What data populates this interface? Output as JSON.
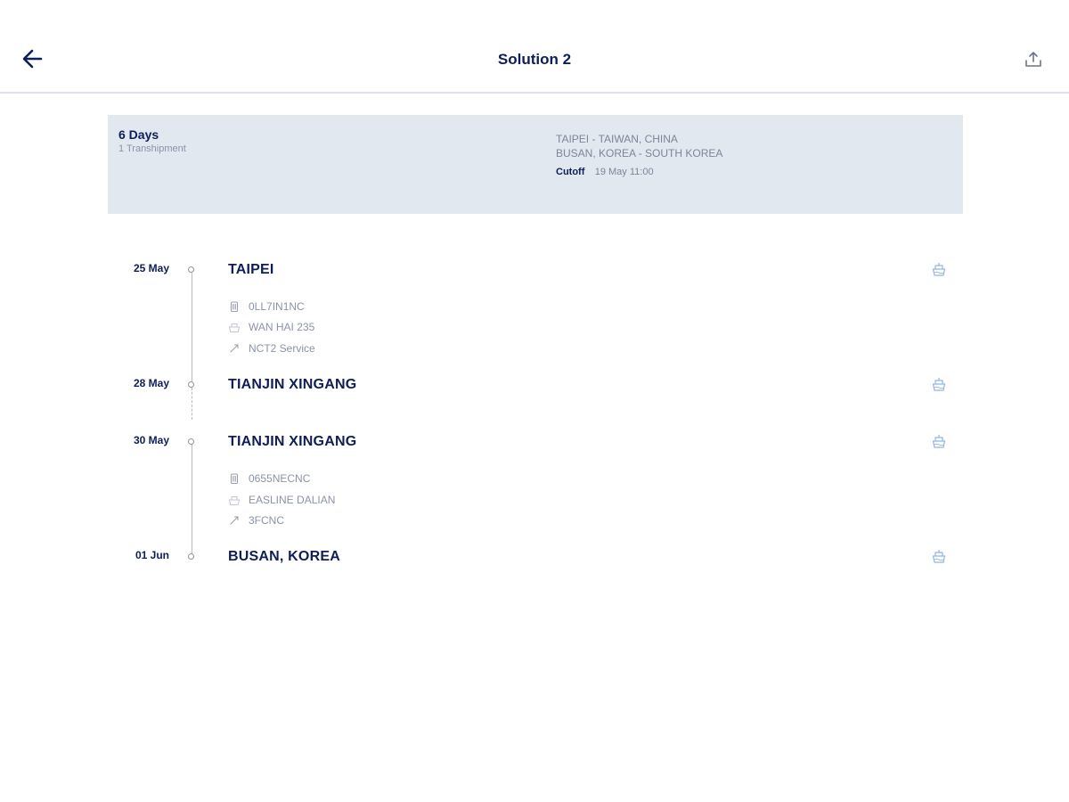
{
  "header": {
    "title": "Solution 2",
    "back_icon": "arrow-left-icon",
    "share_icon": "upload-share-icon"
  },
  "summary": {
    "duration": "6 Days",
    "transshipments": "1 Transhipment",
    "origin": "TAIPEI - TAIWAN, CHINA",
    "destination": "BUSAN, KOREA - SOUTH KOREA",
    "cutoff_label": "Cutoff",
    "cutoff_value": "19 May 11:00"
  },
  "stops": [
    {
      "date": "25 May",
      "name": "TAIPEI",
      "details": [
        {
          "icon": "container-icon",
          "text": "0LL7IN1NC"
        },
        {
          "icon": "ship-icon",
          "text": "WAN HAI 235"
        },
        {
          "icon": "route-icon",
          "text": "NCT2 Service"
        }
      ]
    },
    {
      "date": "28 May",
      "name": "TIANJIN XINGANG"
    },
    {
      "date": "30 May",
      "name": "TIANJIN XINGANG",
      "details": [
        {
          "icon": "container-icon",
          "text": "0655NECNC"
        },
        {
          "icon": "ship-icon",
          "text": "EASLINE DALIAN"
        },
        {
          "icon": "route-icon",
          "text": "3FCNC"
        }
      ]
    },
    {
      "date": "01 Jun",
      "name": "BUSAN, KOREA"
    }
  ],
  "colors": {
    "primary": "#0e1e58",
    "summary_bg": "#e2e8f0",
    "muted_text": "#8a93a6",
    "action_icon": "#8fb4e6"
  }
}
